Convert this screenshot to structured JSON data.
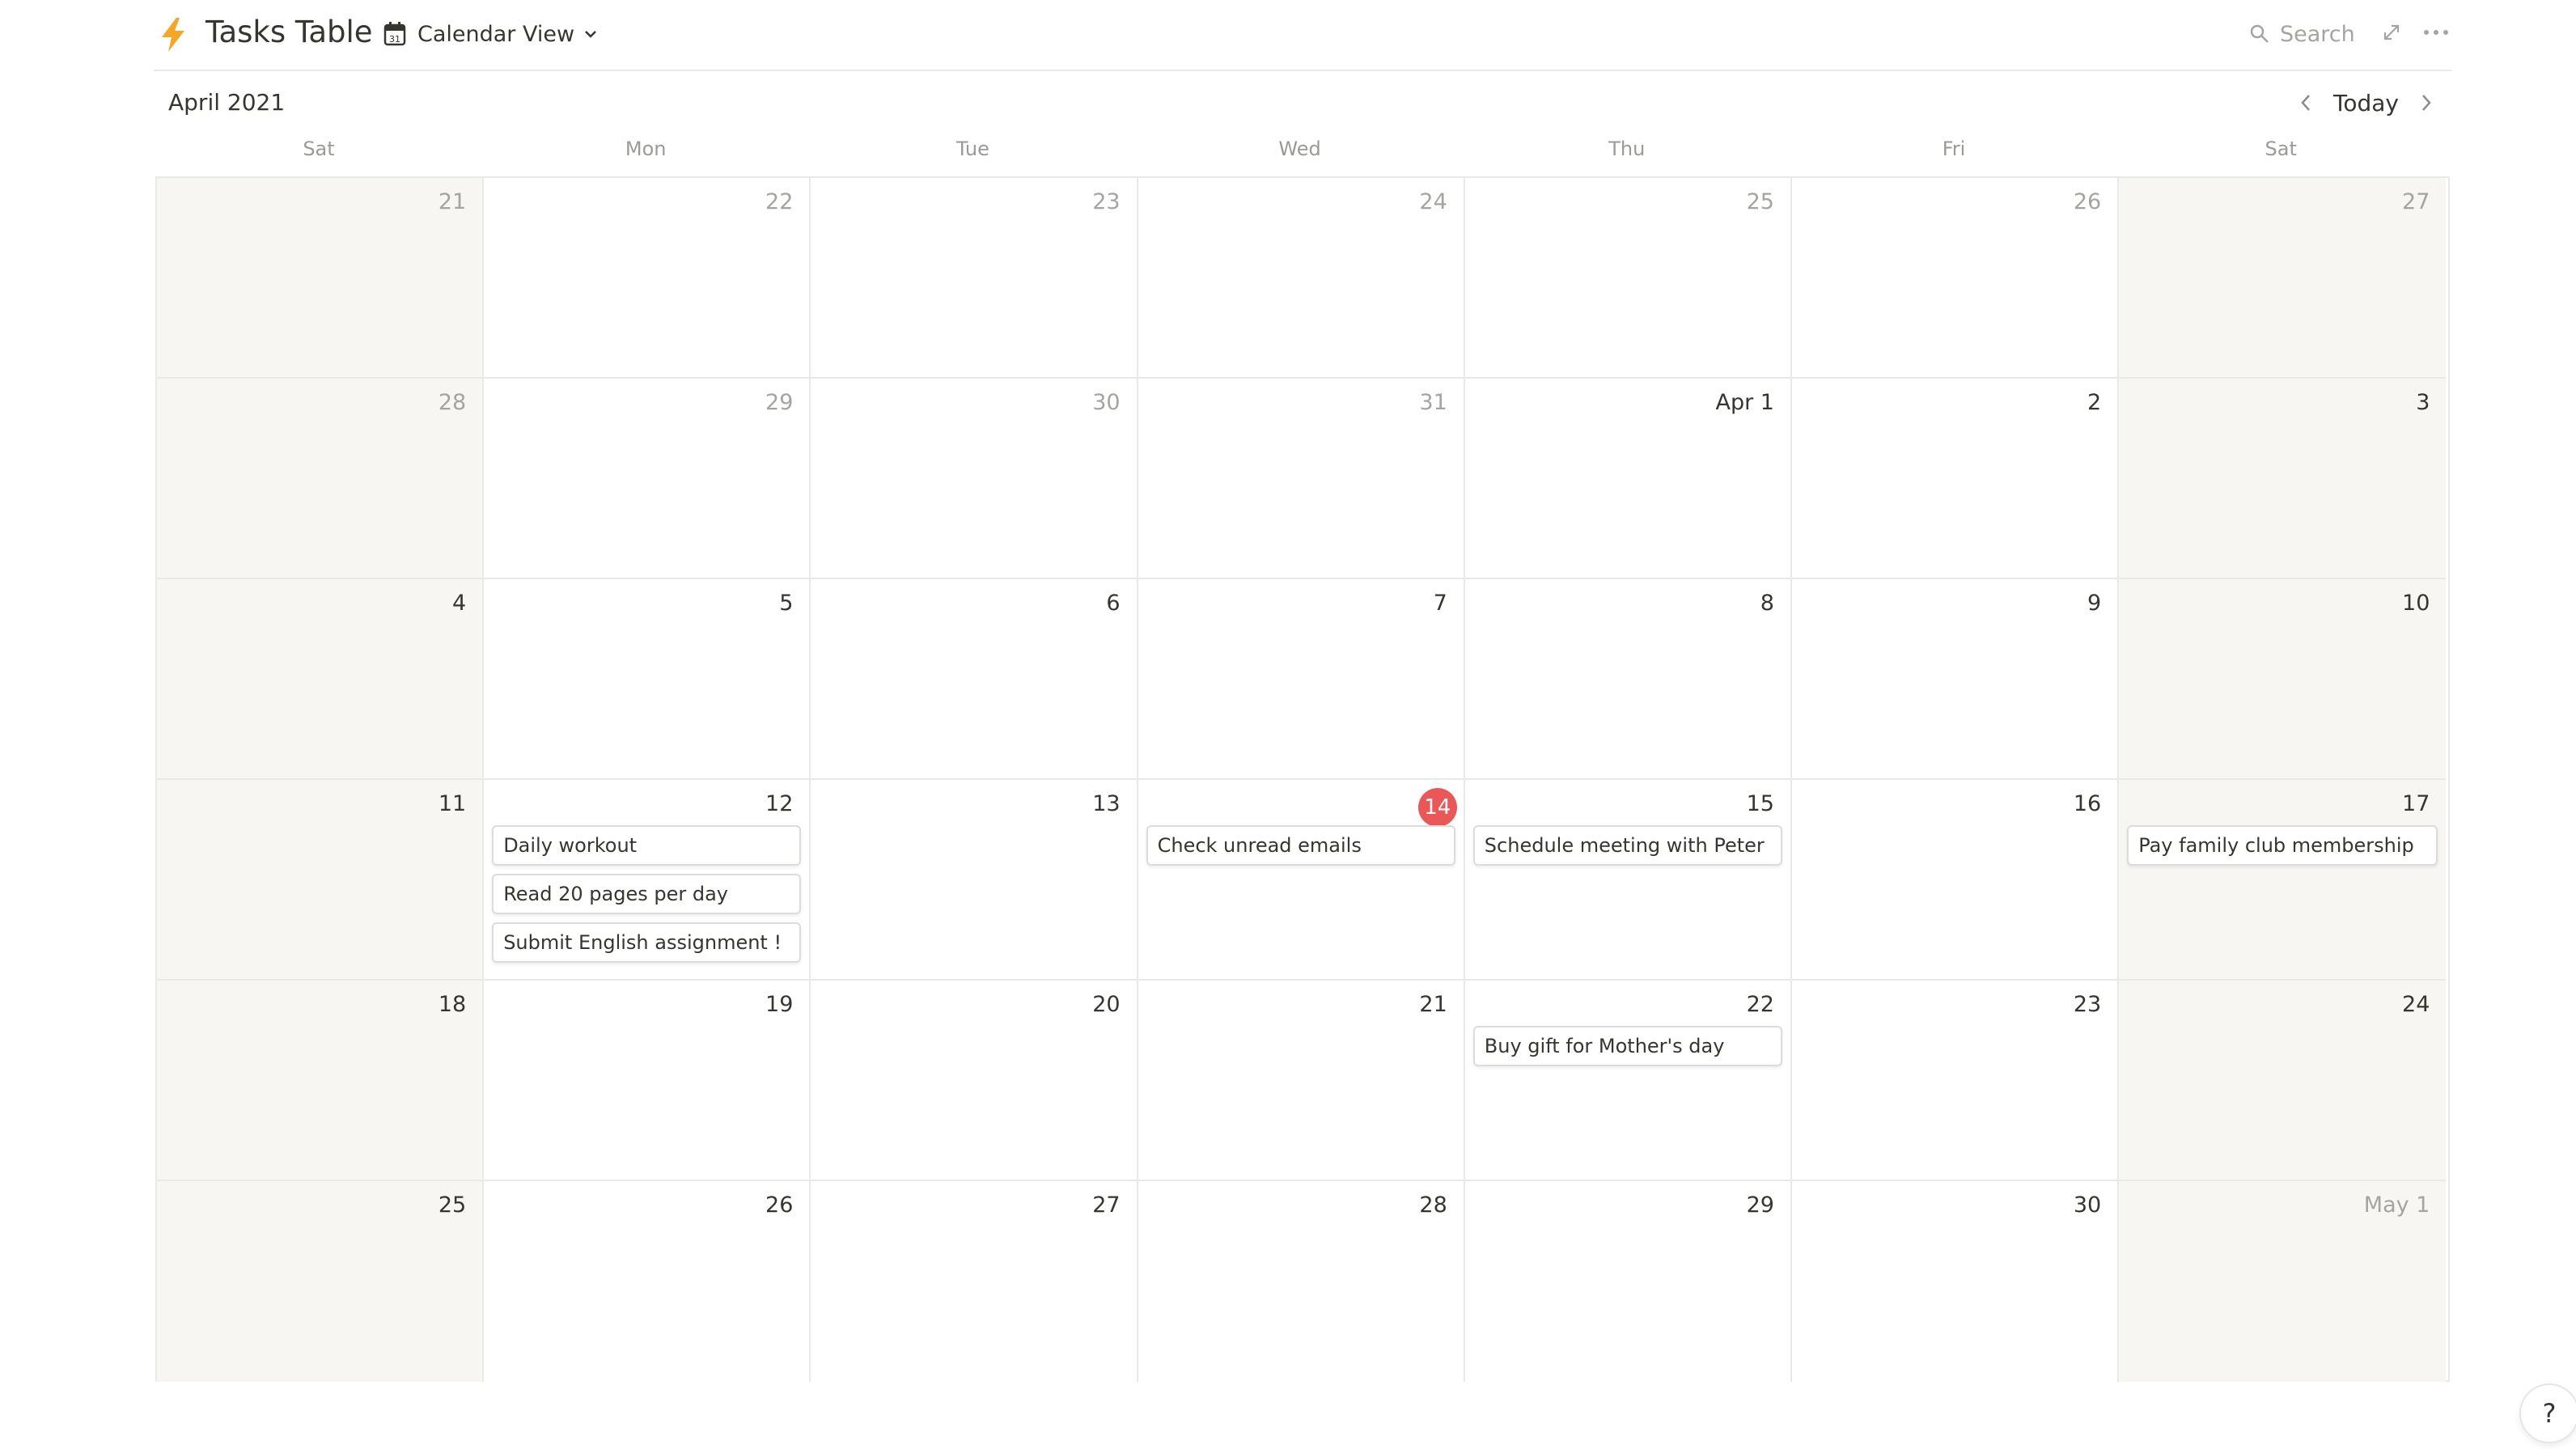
{
  "header": {
    "title": "Tasks Table",
    "view_label": "Calendar View",
    "search_label": "Search"
  },
  "month": {
    "label": "April 2021",
    "today_label": "Today"
  },
  "weekdays": [
    "Sat",
    "Mon",
    "Tue",
    "Wed",
    "Thu",
    "Fri",
    "Sat"
  ],
  "weeks": [
    [
      {
        "label": "21",
        "muted": true,
        "weekend": true,
        "events": []
      },
      {
        "label": "22",
        "muted": true,
        "events": []
      },
      {
        "label": "23",
        "muted": true,
        "events": []
      },
      {
        "label": "24",
        "muted": true,
        "events": []
      },
      {
        "label": "25",
        "muted": true,
        "events": []
      },
      {
        "label": "26",
        "muted": true,
        "events": []
      },
      {
        "label": "27",
        "muted": true,
        "weekend": true,
        "events": []
      }
    ],
    [
      {
        "label": "28",
        "muted": true,
        "weekend": true,
        "events": []
      },
      {
        "label": "29",
        "muted": true,
        "events": []
      },
      {
        "label": "30",
        "muted": true,
        "events": []
      },
      {
        "label": "31",
        "muted": true,
        "events": []
      },
      {
        "label": "Apr 1",
        "events": []
      },
      {
        "label": "2",
        "events": []
      },
      {
        "label": "3",
        "weekend": true,
        "events": []
      }
    ],
    [
      {
        "label": "4",
        "weekend": true,
        "events": []
      },
      {
        "label": "5",
        "events": []
      },
      {
        "label": "6",
        "events": []
      },
      {
        "label": "7",
        "events": []
      },
      {
        "label": "8",
        "events": []
      },
      {
        "label": "9",
        "events": []
      },
      {
        "label": "10",
        "weekend": true,
        "events": []
      }
    ],
    [
      {
        "label": "11",
        "weekend": true,
        "events": []
      },
      {
        "label": "12",
        "events": [
          "Daily workout",
          "Read 20 pages per day",
          "Submit English assignment !"
        ]
      },
      {
        "label": "13",
        "events": []
      },
      {
        "label": "14",
        "today": true,
        "events": [
          "Check unread emails"
        ]
      },
      {
        "label": "15",
        "events": [
          "Schedule meeting with Peter"
        ]
      },
      {
        "label": "16",
        "events": []
      },
      {
        "label": "17",
        "weekend": true,
        "events": [
          "Pay family club membership"
        ]
      }
    ],
    [
      {
        "label": "18",
        "weekend": true,
        "events": []
      },
      {
        "label": "19",
        "events": []
      },
      {
        "label": "20",
        "events": []
      },
      {
        "label": "21",
        "events": []
      },
      {
        "label": "22",
        "events": [
          "Buy gift for Mother's day"
        ]
      },
      {
        "label": "23",
        "events": []
      },
      {
        "label": "24",
        "weekend": true,
        "events": []
      }
    ],
    [
      {
        "label": "25",
        "weekend": true,
        "events": []
      },
      {
        "label": "26",
        "events": []
      },
      {
        "label": "27",
        "events": []
      },
      {
        "label": "28",
        "events": []
      },
      {
        "label": "29",
        "events": []
      },
      {
        "label": "30",
        "events": []
      },
      {
        "label": "May 1",
        "muted": true,
        "weekend": true,
        "events": []
      }
    ]
  ],
  "help_label": "?",
  "colors": {
    "accent_today": "#eb5757",
    "bolt": "#f5a623",
    "weekend_bg": "#f7f6f3",
    "border": "#e9e9e7"
  },
  "icons": {
    "title": "lightning-bolt-icon",
    "view": "calendar-icon",
    "search": "search-icon",
    "expand": "expand-icon",
    "more": "more-icon"
  }
}
